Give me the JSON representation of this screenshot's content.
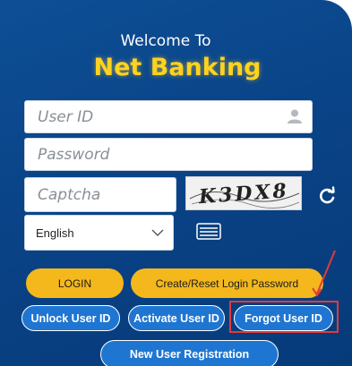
{
  "header": {
    "welcome": "Welcome To",
    "title": "Net Banking"
  },
  "form": {
    "user_id_placeholder": "User ID",
    "password_placeholder": "Password",
    "captcha_placeholder": "Captcha",
    "captcha_text": "K3DX8",
    "language_selected": "English"
  },
  "buttons": {
    "login": "LOGIN",
    "create_reset": "Create/Reset Login Password",
    "unlock": "Unlock User ID",
    "activate": "Activate User ID",
    "forgot": "Forgot User ID",
    "new_user": "New User Registration"
  },
  "icons": {
    "user": "user-icon",
    "refresh": "refresh-icon",
    "chevron": "chevron-down-icon",
    "keyboard": "virtual-keyboard-icon"
  },
  "colors": {
    "panel": "#0a4387",
    "title": "#ffd21f",
    "yellow_button": "#f4b81c",
    "blue_button": "#1f76d2",
    "highlight": "#e23a3a"
  }
}
